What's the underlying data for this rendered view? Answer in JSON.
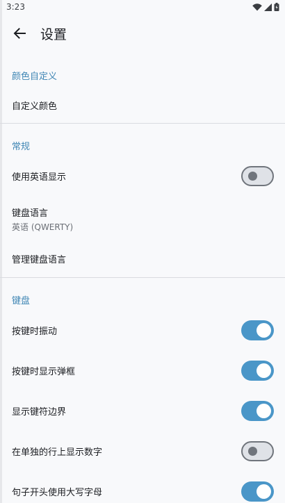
{
  "status_bar": {
    "time": "3:23"
  },
  "app_bar": {
    "title": "设置"
  },
  "sections": {
    "color": {
      "header": "颜色自定义",
      "custom_color": "自定义颜色"
    },
    "general": {
      "header": "常规",
      "use_english": "使用英语显示",
      "keyboard_language": "键盘语言",
      "keyboard_language_value": "英语 (QWERTY)",
      "manage_languages": "管理键盘语言"
    },
    "keyboard": {
      "header": "键盘",
      "vibrate": "按键时振动",
      "popup": "按键时显示弹框",
      "borders": "显示键符边界",
      "number_row": "在单独的行上显示数字",
      "capitalize": "句子开头使用大写字母"
    }
  },
  "toggles": {
    "use_english": false,
    "vibrate": true,
    "popup": true,
    "borders": true,
    "number_row": false,
    "capitalize": true
  },
  "colors": {
    "accent": "#4a96c8",
    "section_header": "#3f86b4"
  }
}
